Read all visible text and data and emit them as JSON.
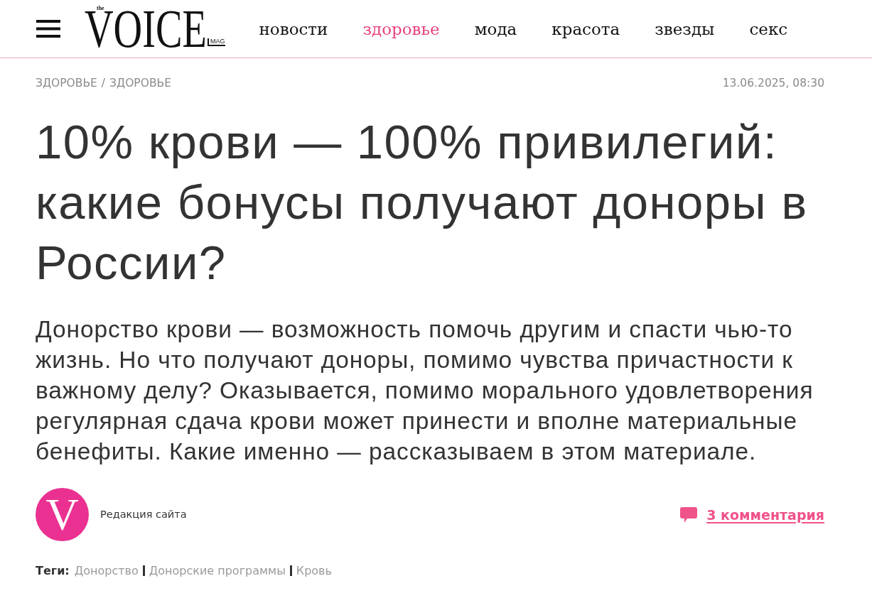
{
  "logo": {
    "prefix": "the",
    "name": "VOICE",
    "suffix": "MAG"
  },
  "nav": [
    {
      "label": "новости",
      "selected": false
    },
    {
      "label": "здоровье",
      "selected": true
    },
    {
      "label": "мода",
      "selected": false
    },
    {
      "label": "красота",
      "selected": false
    },
    {
      "label": "звезды",
      "selected": false
    },
    {
      "label": "секс",
      "selected": false
    }
  ],
  "breadcrumb": {
    "items": [
      "ЗДОРОВЬЕ",
      "ЗДОРОВЬЕ"
    ],
    "separator": "/"
  },
  "date": "13.06.2025, 08:30",
  "headline": "10% крови — 100% привилегий: какие бонусы получают доноры в России?",
  "lead": "Донорство крови — возможность помочь другим и спасти чью-то жизнь. Но что получают доноры, помимо чувства причастности к важному делу? Оказывается, помимо морального удовлетворения регулярная сдача крови может принести и вполне материальные бенефиты. Какие именно — рассказываем в этом материале.",
  "author": {
    "avatar_letter": "V",
    "name": "Редакция сайта"
  },
  "comments": {
    "label": "3 комментария"
  },
  "tags": {
    "heading": "Теги:",
    "items": [
      "Донорство",
      "Донорские программы",
      "Кровь"
    ]
  }
}
